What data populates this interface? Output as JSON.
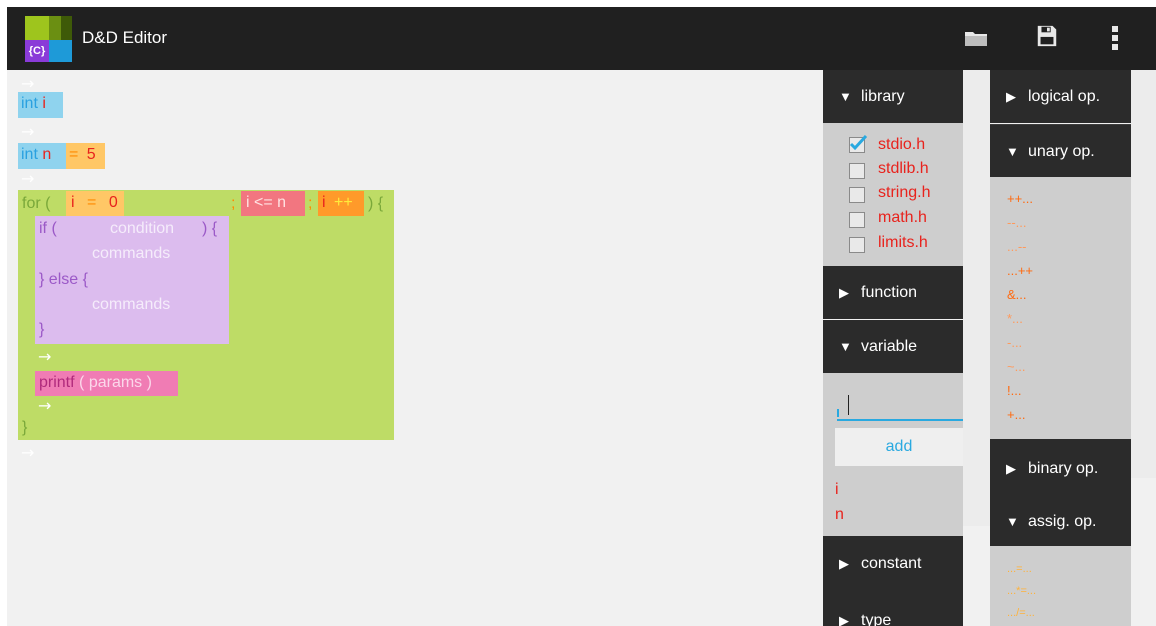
{
  "app": {
    "title": "D&D Editor",
    "logo_text": "{C}"
  },
  "actionbar": {
    "icons": [
      "folder-icon",
      "save-icon",
      "overflow-menu-icon"
    ]
  },
  "code": {
    "line1": {
      "type": "int",
      "name": "i"
    },
    "line2": {
      "type": "int",
      "name": "n",
      "op": "=",
      "value": "5"
    },
    "for_kw": "for (",
    "for_init_var": "i",
    "for_init_op": "=",
    "for_init_val": "0",
    "semi1": ";",
    "for_cond": "i <= n",
    "semi2": ";",
    "for_inc_var": "i",
    "for_inc_op": "++",
    "for_close": ") {",
    "if_kw": "if (",
    "if_cond": "condition",
    "if_close": ") {",
    "commands1": "commands",
    "else_kw": "} else {",
    "commands2": "commands",
    "if_end": "}",
    "printf_kw": "printf",
    "printf_open": "(",
    "printf_params": "params",
    "printf_close": ")",
    "for_end": "}"
  },
  "panel1": {
    "library": {
      "label": "library",
      "expanded": true,
      "items": [
        {
          "name": "stdio.h",
          "checked": true
        },
        {
          "name": "stdlib.h",
          "checked": false
        },
        {
          "name": "string.h",
          "checked": false
        },
        {
          "name": "math.h",
          "checked": false
        },
        {
          "name": "limits.h",
          "checked": false
        }
      ]
    },
    "function": {
      "label": "function",
      "expanded": false
    },
    "variable": {
      "label": "variable",
      "expanded": true,
      "input_value": "",
      "add_label": "add",
      "vars": [
        "i",
        "n"
      ]
    },
    "constant": {
      "label": "constant",
      "expanded": false
    },
    "type": {
      "label": "type",
      "expanded": false
    }
  },
  "panel2": {
    "logical": {
      "label": "logical op.",
      "expanded": false
    },
    "unary": {
      "label": "unary op.",
      "expanded": true,
      "items": [
        "++...",
        "--...",
        "...--",
        "...++",
        "&...",
        "*...",
        "-...",
        "~...",
        "!...",
        "+..."
      ]
    },
    "binary": {
      "label": "binary op.",
      "expanded": false
    },
    "assig": {
      "label": "assig. op.",
      "expanded": true,
      "items": [
        "...=...",
        "...*=...",
        ".../=..."
      ]
    }
  },
  "colors": {
    "int_block": "#8fd3ee",
    "assign_block": "#ffc766",
    "for_block": "#bedc66",
    "if_block": "#dcbcee",
    "printf_block": "#f07cb4",
    "cond_block": "#f27680",
    "inc_block": "#ff9a2a",
    "text_red": "#e8231d",
    "text_orange": "#ff6a10",
    "accent_blue": "#29a9e0"
  }
}
